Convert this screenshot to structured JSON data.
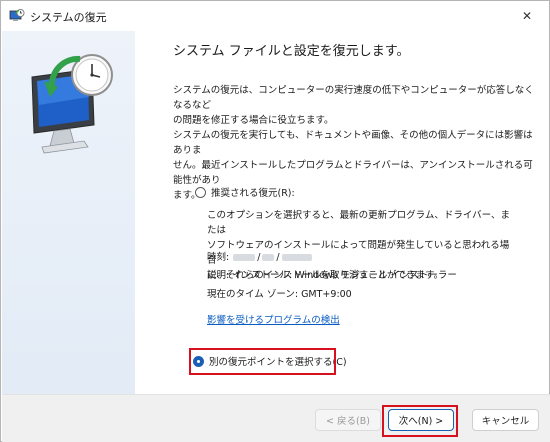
{
  "window": {
    "title": "システムの復元",
    "close_glyph": "✕"
  },
  "main": {
    "heading": "システム ファイルと設定を復元します。",
    "para1_line1": "システムの復元は、コンピューターの実行速度の低下やコンピューターが応答しなくなるなど",
    "para1_line2": "の問題を修正する場合に役立ちます。",
    "para2_line1": "システムの復元を実行しても、ドキュメントや画像、その他の個人データには影響はありま",
    "para2_line2": "せん。最近インストールしたプログラムとドライバーは、アンインストールされる可能性があり",
    "para2_line3": "ます。"
  },
  "recommended": {
    "label": "推奨される復元(R):",
    "selected": false,
    "desc_line1": "このオプションを選択すると、最新の更新プログラム、ドライバー、または",
    "desc_line2": "ソフトウェアのインストールによって問題が発生していると思われる場合",
    "desc_line3": "に、それらのインストールを取り消すことができます。",
    "time_label": "時刻:",
    "time_sep1": "/",
    "time_sep2": "/",
    "description": "説明: インストール: Windows モジュール インストーラー",
    "timezone": "現在のタイム ゾーン: GMT+9:00",
    "link": "影響を受けるプログラムの検出"
  },
  "other": {
    "label": "別の復元ポイントを選択する(C)",
    "selected": true
  },
  "footer": {
    "back_label": "< 戻る(B)",
    "next_label": "次へ(N) >",
    "cancel_label": "キャンセル"
  },
  "icons": [
    "system-restore-icon",
    "close-icon",
    "restore-hero-icon"
  ],
  "colors": {
    "accent": "#1a5fb4",
    "highlight": "#d7101f",
    "link": "#0a5cc2",
    "footer_bg": "#f0f0f0",
    "side_panel": "#e6eef8"
  }
}
